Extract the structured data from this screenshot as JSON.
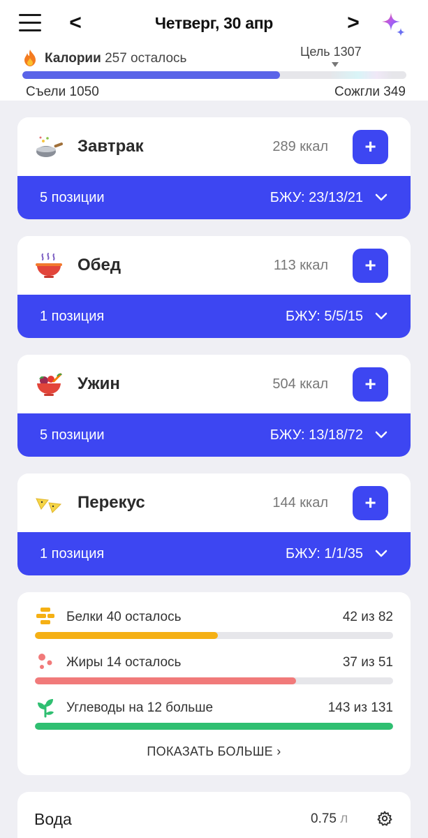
{
  "header": {
    "date": "Четверг, 30 апр",
    "prev": "<",
    "next": ">",
    "calories_label": "Калории",
    "calories_remaining": "257 осталось",
    "goal": "Цель 1307",
    "eaten": "Съели 1050",
    "burned": "Сожгли 349",
    "calorie_progress_percent": 67
  },
  "meals": [
    {
      "name": "Завтрак",
      "kcal": "289 ккал",
      "items": "5 позиции",
      "macros": "БЖУ: 23/13/21",
      "icon": "wok-icon"
    },
    {
      "name": "Обед",
      "kcal": "113 ккал",
      "items": "1 позиция",
      "macros": "БЖУ: 5/5/15",
      "icon": "soup-bowl-icon"
    },
    {
      "name": "Ужин",
      "kcal": "504 ккал",
      "items": "5 позиции",
      "macros": "БЖУ: 13/18/72",
      "icon": "salad-bowl-icon"
    },
    {
      "name": "Перекус",
      "kcal": "144 ккал",
      "items": "1 позиция",
      "macros": "БЖУ: 1/1/35",
      "icon": "nachos-icon"
    }
  ],
  "add_label": "+",
  "macros": [
    {
      "name": "Белки 40 осталось",
      "value": "42 из 82",
      "progress_percent": 51,
      "color": "#f5b014"
    },
    {
      "name": "Жиры 14 осталось",
      "value": "37 из 51",
      "progress_percent": 73,
      "color": "#f17a7a"
    },
    {
      "name": "Углеводы на 12 больше",
      "value": "143 из 131",
      "progress_percent": 100,
      "color": "#2fbf71"
    }
  ],
  "show_more": "ПОКАЗАТЬ БОЛЬШЕ ›",
  "water": {
    "title": "Вода",
    "value": "0.75",
    "unit": "л"
  },
  "colors": {
    "accent": "#3d46f2",
    "calorie_bar": "#5a64e8",
    "background": "#efeff4"
  }
}
